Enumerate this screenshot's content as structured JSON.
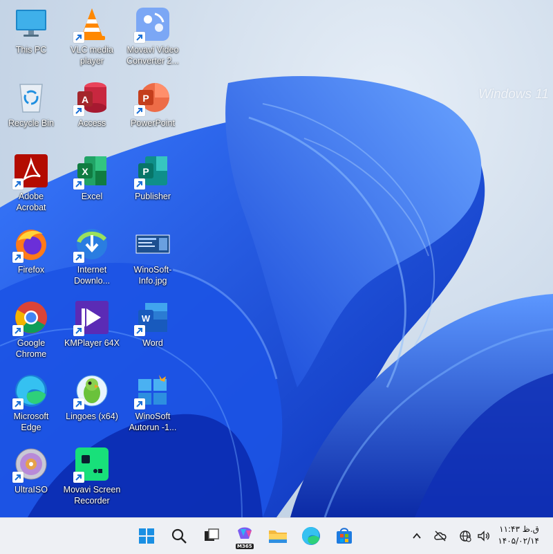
{
  "desktop": {
    "watermark": {
      "title": "Windows 11",
      "subtitle": ""
    },
    "icons": [
      {
        "label": "This PC",
        "icon": "monitor-icon",
        "shortcut": false
      },
      {
        "label": "VLC media\nplayer",
        "icon": "vlc-icon",
        "shortcut": true
      },
      {
        "label": "Movavi Video\nConverter 2...",
        "icon": "movavi-converter-icon",
        "shortcut": true
      },
      {
        "label": "Recycle Bin",
        "icon": "recycle-bin-icon",
        "shortcut": false
      },
      {
        "label": "Access",
        "icon": "access-icon",
        "shortcut": true
      },
      {
        "label": "PowerPoint",
        "icon": "powerpoint-icon",
        "shortcut": true
      },
      {
        "label": "Adobe\nAcrobat",
        "icon": "acrobat-icon",
        "shortcut": true
      },
      {
        "label": "Excel",
        "icon": "excel-icon",
        "shortcut": true
      },
      {
        "label": "Publisher",
        "icon": "publisher-icon",
        "shortcut": true
      },
      {
        "label": "Firefox",
        "icon": "firefox-icon",
        "shortcut": true
      },
      {
        "label": "Internet\nDownlo...",
        "icon": "idm-icon",
        "shortcut": true
      },
      {
        "label": "WinoSoft-\nInfo.jpg",
        "icon": "image-file-icon",
        "shortcut": false
      },
      {
        "label": "Google\nChrome",
        "icon": "chrome-icon",
        "shortcut": true
      },
      {
        "label": "KMPlayer 64X",
        "icon": "kmplayer-icon",
        "shortcut": true
      },
      {
        "label": "Word",
        "icon": "word-icon",
        "shortcut": true
      },
      {
        "label": "Microsoft\nEdge",
        "icon": "edge-icon",
        "shortcut": true
      },
      {
        "label": "Lingoes (x64)",
        "icon": "lingoes-icon",
        "shortcut": true
      },
      {
        "label": "WinoSoft\nAutorun -1...",
        "icon": "winosoft-autorun-icon",
        "shortcut": true
      },
      {
        "label": "UltraISO",
        "icon": "ultraiso-icon",
        "shortcut": true
      },
      {
        "label": "Movavi Screen\nRecorder",
        "icon": "movavi-recorder-icon",
        "shortcut": true
      }
    ]
  },
  "taskbar": {
    "apps": [
      "start-icon",
      "search-icon",
      "task-view-icon",
      "m365-copilot-icon",
      "file-explorer-icon",
      "edge-icon",
      "microsoft-store-icon"
    ],
    "m365_badge": "M365",
    "tray": [
      "chevron-up-icon",
      "cloud-offline-icon",
      "network-globe-icon",
      "volume-icon"
    ],
    "time": "۱۱:۴۳ ق.ظ",
    "date": "۱۴۰۵/۰۲/۱۴"
  }
}
